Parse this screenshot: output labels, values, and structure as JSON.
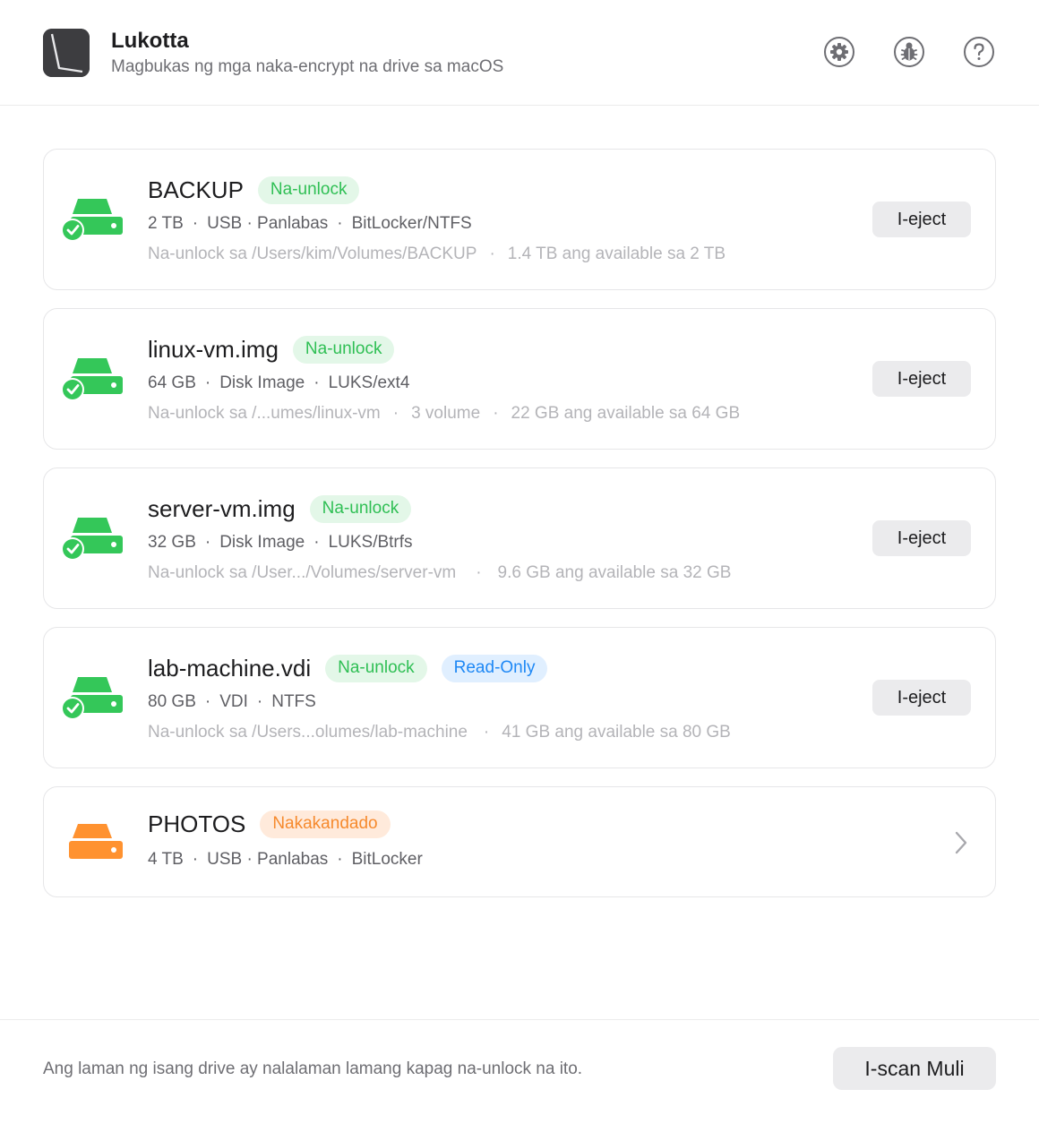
{
  "app": {
    "title": "Lukotta",
    "subtitle": "Magbukas ng mga naka-encrypt na drive sa macOS",
    "icon": "app-logo-icon"
  },
  "header_buttons": [
    {
      "icon": "gear-icon"
    },
    {
      "icon": "bug-icon"
    },
    {
      "icon": "help-icon"
    }
  ],
  "drives": [
    {
      "name": "BACKUP",
      "status": "Na-unlock",
      "size": "2 TB",
      "type": "USB · Panlabas",
      "format": "BitLocker/NTFS",
      "mount": "Na-unlock sa /Users/kim/Volumes/BACKUP",
      "space": "1.4 TB ang available sa 2 TB",
      "action": "I-eject"
    },
    {
      "name": "linux-vm.img",
      "status": "Na-unlock",
      "size": "64 GB",
      "type": "Disk Image",
      "format": "LUKS/ext4",
      "mount": "Na-unlock sa /...umes/linux-vm",
      "volumes": "3 volume",
      "space": "22 GB ang available sa 64 GB",
      "action": "I-eject"
    },
    {
      "name": "server-vm.img",
      "status": "Na-unlock",
      "size": "32 GB",
      "type": "Disk Image",
      "format": "LUKS/Btrfs",
      "mount": "Na-unlock sa /User.../Volumes/server-vm",
      "space": "9.6 GB ang available sa 32 GB",
      "action": "I-eject"
    },
    {
      "name": "lab-machine.vdi",
      "status": "Na-unlock",
      "extra_badge": "Read-Only",
      "size": "80 GB",
      "type": "VDI",
      "format": "NTFS",
      "mount": "Na-unlock sa /Users...olumes/lab-machine",
      "space": "41 GB ang available sa 80 GB",
      "action": "I-eject"
    },
    {
      "name": "PHOTOS",
      "status": "Nakakandado",
      "size": "4 TB",
      "type": "USB · Panlabas",
      "format": "BitLocker"
    }
  ],
  "footer": {
    "note": "Ang laman ng isang drive ay nalalaman lamang kapag na-unlock na ito.",
    "rescan_label": "I-scan Muli"
  },
  "colors": {
    "unlocked": "#34c759",
    "locked": "#ff9230",
    "read_only": "#1e88f5"
  }
}
